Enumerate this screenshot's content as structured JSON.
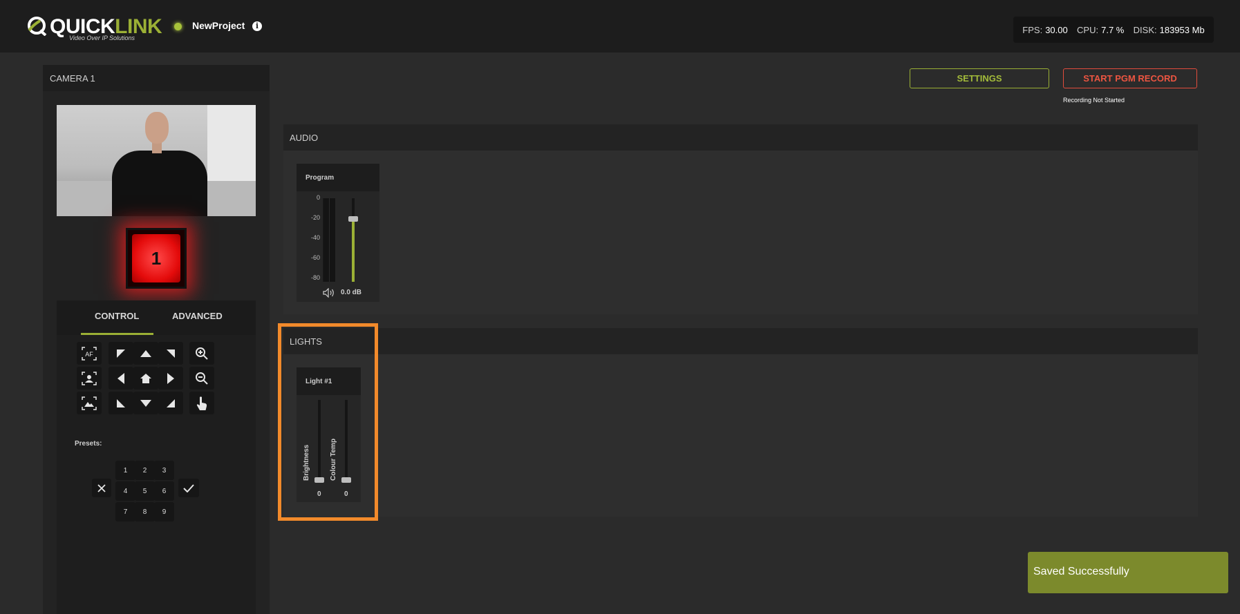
{
  "header": {
    "logo_text_a": "QUICK",
    "logo_text_b": "LINK",
    "logo_tagline": "Video Over IP Solutions",
    "project_name": "NewProject",
    "info_icon": "i",
    "stats": {
      "fps_label": "FPS:",
      "fps_value": "30.00",
      "cpu_label": "CPU:",
      "cpu_value": "7.7 %",
      "disk_label": "DISK:",
      "disk_value": "183953 Mb"
    }
  },
  "camera": {
    "title": "CAMERA 1",
    "tally_number": "1",
    "tabs": [
      "CONTROL",
      "ADVANCED"
    ],
    "active_tab": "CONTROL",
    "af_label": "AF",
    "presets_label": "Presets:",
    "presets": [
      "1",
      "2",
      "3",
      "4",
      "5",
      "6",
      "7",
      "8",
      "9"
    ]
  },
  "toolbar": {
    "settings_label": "SETTINGS",
    "record_label": "START PGM RECORD",
    "record_status": "Recording Not Started"
  },
  "audio": {
    "title": "AUDIO",
    "channel": "Program",
    "scale": [
      "0",
      "-20",
      "-40",
      "-60",
      "-80"
    ],
    "level_db": "0.0 dB"
  },
  "lights": {
    "title": "LIGHTS",
    "light_name": "Light #1",
    "brightness_label": "Brightness",
    "brightness_value": "0",
    "colour_temp_label": "Colour Temp",
    "colour_temp_value": "0"
  },
  "toast": {
    "message": "Saved Successfully"
  },
  "colors": {
    "accent": "#9bb035",
    "record": "#e24c3c",
    "highlight": "#f28a2b",
    "tally": "#e40b0b"
  }
}
